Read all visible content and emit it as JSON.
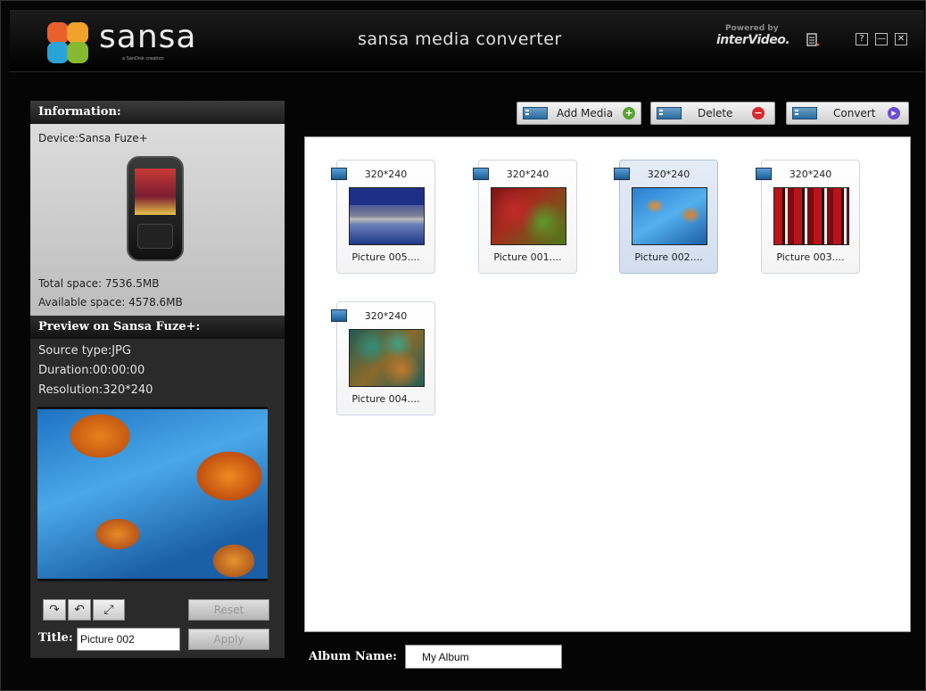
{
  "app": {
    "logo_text": "sansa",
    "logo_sub": "a SanDisk creation",
    "title": "sansa media converter",
    "powered_by": "Powered by",
    "powered_brand": "interVideo.",
    "help_glyph": "?",
    "min_glyph": "—",
    "close_glyph": "✕"
  },
  "info": {
    "header": "Information:",
    "device": "Device:Sansa Fuze+",
    "total_space": "Total space: 7536.5MB",
    "available_space": "Available space: 4578.6MB"
  },
  "preview": {
    "header": "Preview on Sansa Fuze+:",
    "source_type": "Source type:JPG",
    "duration": "Duration:00:00:00",
    "resolution": "Resolution:320*240",
    "rotate_right_glyph": "↷",
    "rotate_left_glyph": "↶",
    "fit_glyph": "⤢",
    "reset_label": "Reset",
    "title_label": "Title:",
    "title_value": "Picture 002",
    "apply_label": "Apply"
  },
  "toolbar": {
    "add_label": "Add Media",
    "delete_label": "Delete",
    "convert_label": "Convert",
    "add_badge": "+",
    "delete_badge": "−",
    "convert_badge": "▸"
  },
  "media": [
    {
      "resolution": "320*240",
      "name": "Picture 005....",
      "selected": false
    },
    {
      "resolution": "320*240",
      "name": "Picture 001....",
      "selected": false
    },
    {
      "resolution": "320*240",
      "name": "Picture 002....",
      "selected": true
    },
    {
      "resolution": "320*240",
      "name": "Picture 003....",
      "selected": false
    },
    {
      "resolution": "320*240",
      "name": "Picture 004....",
      "selected": false
    }
  ],
  "album": {
    "label": "Album Name:",
    "value": "My Album"
  },
  "colors": {
    "window_bg": "#050505",
    "selected_thumb": "#d2def0",
    "add_badge": "#5aa332",
    "delete_badge": "#d82a2a",
    "convert_badge": "#6a4fd0"
  }
}
